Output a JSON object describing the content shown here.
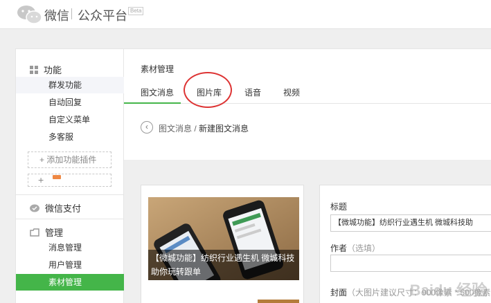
{
  "header": {
    "brand": "微信",
    "brand_sub": "公众平台",
    "beta": "Beta"
  },
  "sidebar": {
    "group_function": "功能",
    "function_items": [
      "群发功能",
      "自动回复",
      "自定义菜单",
      "多客服"
    ],
    "add_plugin": "+ 添加功能插件",
    "add_plus": "+",
    "group_pay": "微信支付",
    "group_manage": "管理",
    "manage_items": [
      "消息管理",
      "用户管理",
      "素材管理"
    ]
  },
  "content": {
    "title": "素材管理",
    "tabs": [
      "图文消息",
      "图片库",
      "语音",
      "视频"
    ],
    "breadcrumb_parent": "图文消息",
    "breadcrumb_sep": " / ",
    "breadcrumb_current": "新建图文消息",
    "card_caption": "【微城功能】纺织行业遇生机 微城科技助你玩转跟单",
    "form": {
      "title_label": "标题",
      "title_value": "【微城功能】纺织行业遇生机  微城科技助",
      "author_label": "作者",
      "author_hint": "（选填）",
      "cover_label": "封面",
      "cover_hint": "（大图片建议尺寸：900像素 * 500像素"
    }
  },
  "watermark": "Baidu 经验",
  "colors": {
    "accent": "#44b549",
    "highlight_circle": "#dd3333"
  }
}
